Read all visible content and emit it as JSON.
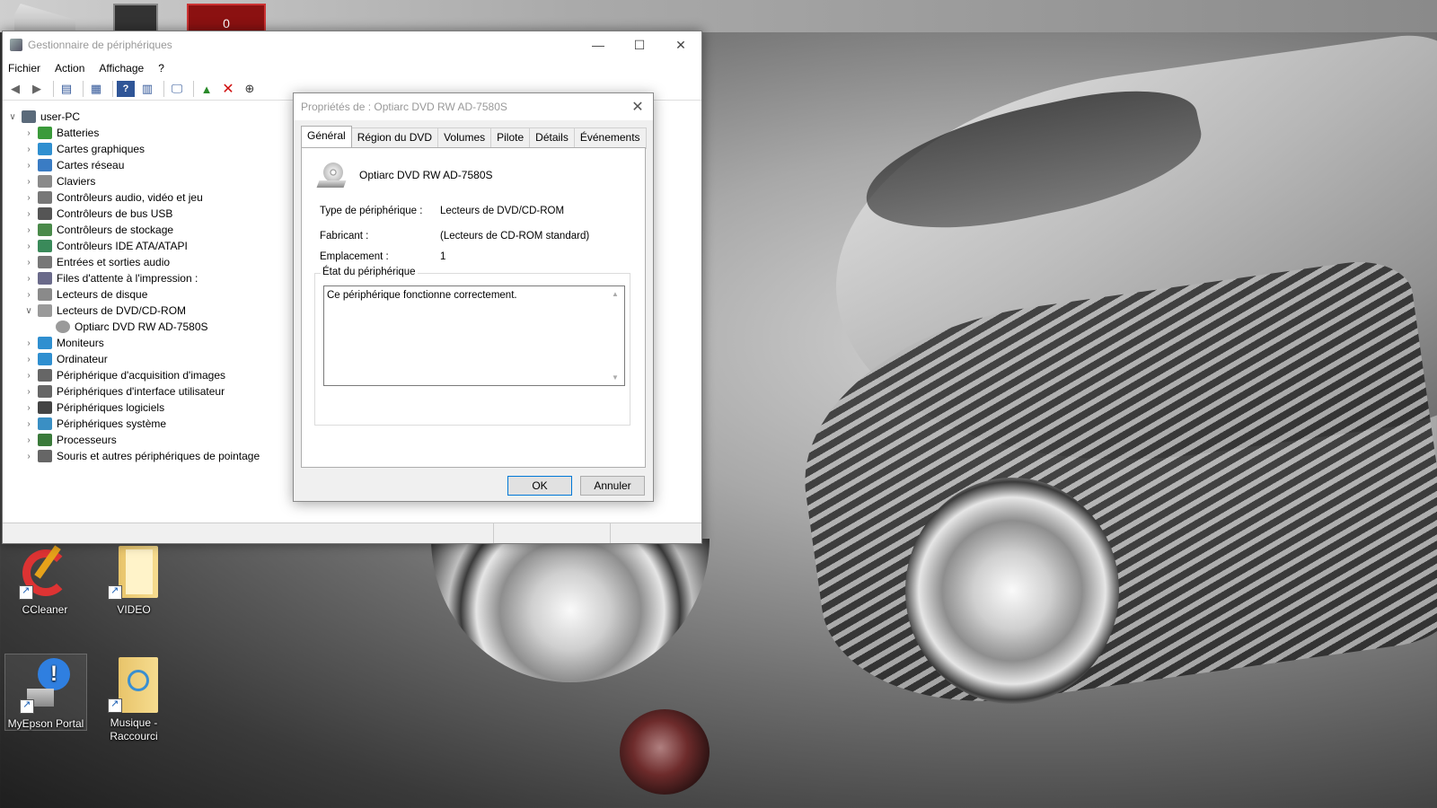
{
  "device_manager": {
    "title": "Gestionnaire de périphériques",
    "menu": [
      "Fichier",
      "Action",
      "Affichage",
      "?"
    ],
    "tree_root": "user-PC",
    "tree": [
      {
        "label": "Batteries",
        "icon": "battery-icon",
        "color": "#3a9a3a",
        "expanded": false
      },
      {
        "label": "Cartes graphiques",
        "icon": "display-adapter-icon",
        "color": "#2f8fd0",
        "expanded": false
      },
      {
        "label": "Cartes réseau",
        "icon": "network-adapter-icon",
        "color": "#3a7cc4",
        "expanded": false
      },
      {
        "label": "Claviers",
        "icon": "keyboard-icon",
        "color": "#8a8a8a",
        "expanded": false
      },
      {
        "label": "Contrôleurs audio, vidéo et jeu",
        "icon": "speaker-icon",
        "color": "#777777",
        "expanded": false
      },
      {
        "label": "Contrôleurs de bus USB",
        "icon": "usb-icon",
        "color": "#555555",
        "expanded": false
      },
      {
        "label": "Contrôleurs de stockage",
        "icon": "storage-controller-icon",
        "color": "#4a8a4a",
        "expanded": false
      },
      {
        "label": "Contrôleurs IDE ATA/ATAPI",
        "icon": "ide-icon",
        "color": "#3a8a5a",
        "expanded": false
      },
      {
        "label": "Entrées et sorties audio",
        "icon": "audio-io-icon",
        "color": "#777777",
        "expanded": false
      },
      {
        "label": "Files d'attente à l'impression :",
        "icon": "printer-icon",
        "color": "#6a6a8a",
        "expanded": false
      },
      {
        "label": "Lecteurs de disque",
        "icon": "disk-drive-icon",
        "color": "#8a8a8a",
        "expanded": false
      },
      {
        "label": "Lecteurs de DVD/CD-ROM",
        "icon": "dvd-drive-icon",
        "color": "#9a9a9a",
        "expanded": true,
        "children": [
          {
            "label": "Optiarc DVD RW AD-7580S",
            "icon": "dvd-icon",
            "color": "#9a9a9a"
          }
        ]
      },
      {
        "label": "Moniteurs",
        "icon": "monitor-icon",
        "color": "#2f8fd0",
        "expanded": false
      },
      {
        "label": "Ordinateur",
        "icon": "computer-icon",
        "color": "#2f8fd0",
        "expanded": false
      },
      {
        "label": "Périphérique d'acquisition d'images",
        "icon": "camera-icon",
        "color": "#666666",
        "expanded": false
      },
      {
        "label": "Périphériques d'interface utilisateur",
        "icon": "hid-icon",
        "color": "#666666",
        "expanded": false
      },
      {
        "label": "Périphériques logiciels",
        "icon": "software-device-icon",
        "color": "#444444",
        "expanded": false
      },
      {
        "label": "Périphériques système",
        "icon": "system-device-icon",
        "color": "#3a8fc4",
        "expanded": false
      },
      {
        "label": "Processeurs",
        "icon": "processor-icon",
        "color": "#3a7a3a",
        "expanded": false
      },
      {
        "label": "Souris et autres périphériques de pointage",
        "icon": "mouse-icon",
        "color": "#666666",
        "expanded": false
      }
    ]
  },
  "dialog": {
    "title": "Propriétés de : Optiarc DVD RW AD-7580S",
    "tabs": [
      "Général",
      "Région du DVD",
      "Volumes",
      "Pilote",
      "Détails",
      "Événements"
    ],
    "device_name": "Optiarc DVD RW AD-7580S",
    "props": [
      {
        "label": "Type de périphérique :",
        "value": "Lecteurs de DVD/CD-ROM"
      },
      {
        "label": "Fabricant :",
        "value": "(Lecteurs de CD-ROM standard)"
      },
      {
        "label": "Emplacement :",
        "value": "1"
      }
    ],
    "status_group": "État du périphérique",
    "status_text": "Ce périphérique fonctionne correctement.",
    "ok": "OK",
    "cancel": "Annuler"
  },
  "desktop_icons": [
    {
      "label": "CCleaner",
      "icon": "ccleaner-icon"
    },
    {
      "label": "VIDEO",
      "icon": "folder-icon"
    },
    {
      "label": "MyEpson Portal",
      "icon": "epson-icon"
    },
    {
      "label": "Musique - Raccourci",
      "icon": "music-folder-icon"
    }
  ],
  "top_bar_badge": "0"
}
